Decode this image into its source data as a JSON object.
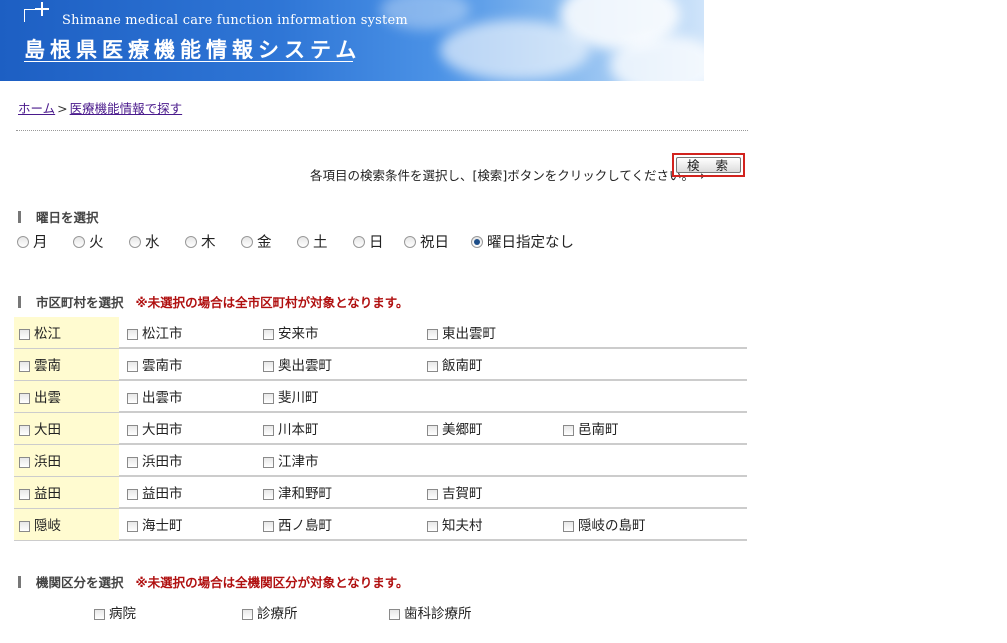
{
  "header": {
    "site_name_en": "Shimane medical care function information system",
    "site_name_jp": "島根県医療機能情報システム"
  },
  "breadcrumb": {
    "home": "ホーム",
    "separator": ">",
    "current": "医療機能情報で探す"
  },
  "instruction": "各項目の検索条件を選択し、[検索]ボタンをクリックしてください。→",
  "search_button_label": "検 索",
  "weekday_section": {
    "title": "曜日を選択",
    "options": [
      {
        "label": "月",
        "checked": false
      },
      {
        "label": "火",
        "checked": false
      },
      {
        "label": "水",
        "checked": false
      },
      {
        "label": "木",
        "checked": false
      },
      {
        "label": "金",
        "checked": false
      },
      {
        "label": "土",
        "checked": false
      },
      {
        "label": "日",
        "checked": false
      },
      {
        "label": "祝日",
        "checked": false
      },
      {
        "label": "曜日指定なし",
        "checked": true
      }
    ]
  },
  "area_section": {
    "title": "市区町村を選択",
    "note": "※未選択の場合は全市区町村が対象となります。",
    "rows": [
      {
        "region": "松江",
        "cities": [
          "松江市",
          "安来市",
          "東出雲町"
        ]
      },
      {
        "region": "雲南",
        "cities": [
          "雲南市",
          "奥出雲町",
          "飯南町"
        ]
      },
      {
        "region": "出雲",
        "cities": [
          "出雲市",
          "斐川町"
        ]
      },
      {
        "region": "大田",
        "cities": [
          "大田市",
          "川本町",
          "美郷町",
          "邑南町"
        ]
      },
      {
        "region": "浜田",
        "cities": [
          "浜田市",
          "江津市"
        ]
      },
      {
        "region": "益田",
        "cities": [
          "益田市",
          "津和野町",
          "吉賀町"
        ]
      },
      {
        "region": "隠岐",
        "cities": [
          "海士町",
          "西ノ島町",
          "知夫村",
          "隠岐の島町"
        ]
      }
    ]
  },
  "institution_section": {
    "title": "機関区分を選択",
    "note": "※未選択の場合は全機関区分が対象となります。",
    "options": [
      "病院",
      "診療所",
      "歯科診療所"
    ]
  }
}
